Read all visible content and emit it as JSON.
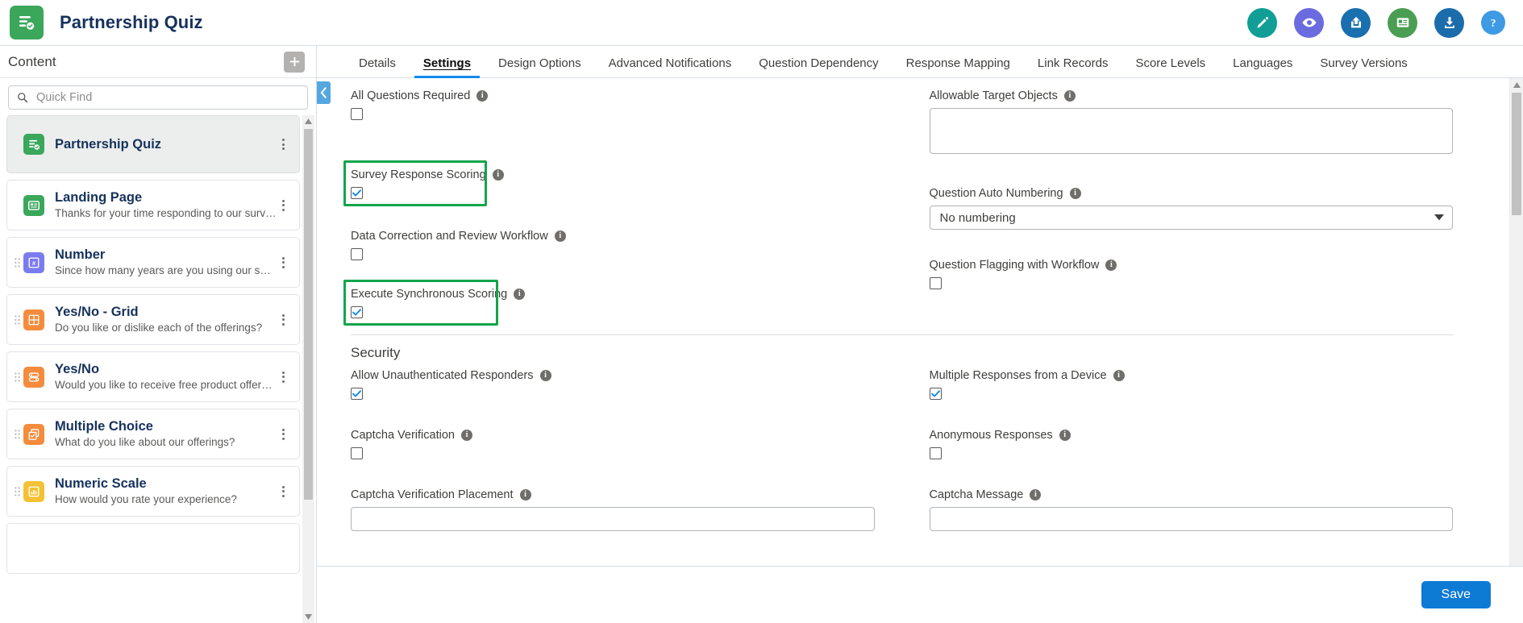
{
  "window": {
    "title": "Partnership Quiz",
    "logo_icon": "survey-form-icon"
  },
  "topbar": {
    "icons": [
      {
        "name": "edit-icon",
        "color": "#109e96"
      },
      {
        "name": "preview-eye-icon",
        "color": "#6b6be0"
      },
      {
        "name": "share-icon",
        "color": "#1a6fae"
      },
      {
        "name": "record-card-icon",
        "color": "#4a9e53"
      },
      {
        "name": "download-icon",
        "color": "#1b6cab"
      },
      {
        "name": "help-icon",
        "color": "#3e9ae3"
      }
    ]
  },
  "sidebar": {
    "header_title": "Content",
    "add_button_label": "+",
    "search": {
      "placeholder": "Quick Find",
      "value": ""
    },
    "items": [
      {
        "title": "Partnership Quiz",
        "subtitle": "",
        "icon": "survey-form-icon",
        "icon_color": "#3aa75b",
        "selected": true,
        "draggable": false
      },
      {
        "title": "Landing Page",
        "subtitle": "Thanks for your time responding to our survey. Please ...",
        "icon": "landing-page-icon",
        "icon_color": "#3aa75b",
        "selected": false,
        "draggable": false
      },
      {
        "title": "Number",
        "subtitle": "Since how many years are you using our services?",
        "icon": "number-question-icon",
        "icon_color": "#7b7bf0",
        "selected": false,
        "draggable": true
      },
      {
        "title": "Yes/No - Grid",
        "subtitle": "Do you like or dislike each of the offerings?",
        "icon": "grid-question-icon",
        "icon_color": "#f58b3c",
        "selected": false,
        "draggable": true
      },
      {
        "title": "Yes/No",
        "subtitle": "Would you like to receive free product offers via email?",
        "icon": "yesno-question-icon",
        "icon_color": "#f58b3c",
        "selected": false,
        "draggable": true
      },
      {
        "title": "Multiple Choice",
        "subtitle": "What do you like about our offerings?",
        "icon": "multiple-choice-icon",
        "icon_color": "#f58b3c",
        "selected": false,
        "draggable": true
      },
      {
        "title": "Numeric Scale",
        "subtitle": "How would you rate your experience?",
        "icon": "numeric-scale-icon",
        "icon_color": "#f4c034",
        "selected": false,
        "draggable": true
      }
    ]
  },
  "main": {
    "tabs": [
      {
        "label": "Details",
        "active": false
      },
      {
        "label": "Settings",
        "active": true
      },
      {
        "label": "Design Options",
        "active": false
      },
      {
        "label": "Advanced Notifications",
        "active": false
      },
      {
        "label": "Question Dependency",
        "active": false
      },
      {
        "label": "Response Mapping",
        "active": false
      },
      {
        "label": "Link Records",
        "active": false
      },
      {
        "label": "Score Levels",
        "active": false
      },
      {
        "label": "Languages",
        "active": false
      },
      {
        "label": "Survey Versions",
        "active": false
      }
    ],
    "collapse_icon": "chevron-left-icon",
    "fields": {
      "all_questions_required": {
        "label": "All Questions Required",
        "checked": false
      },
      "survey_response_scoring": {
        "label": "Survey Response Scoring",
        "checked": true,
        "highlighted": true
      },
      "data_correction_review_workflow": {
        "label": "Data Correction and Review Workflow",
        "checked": false
      },
      "execute_synchronous_scoring": {
        "label": "Execute Synchronous Scoring",
        "checked": true,
        "highlighted": true
      },
      "allowable_target_objects": {
        "label": "Allowable Target Objects",
        "value": ""
      },
      "question_auto_numbering": {
        "label": "Question Auto Numbering",
        "value": "No numbering"
      },
      "question_flagging_with_workflow": {
        "label": "Question Flagging with Workflow",
        "checked": false
      }
    },
    "security": {
      "title": "Security",
      "allow_unauthenticated_responders": {
        "label": "Allow Unauthenticated Responders",
        "checked": true
      },
      "multiple_responses_from_device": {
        "label": "Multiple Responses from a Device",
        "checked": true
      },
      "captcha_verification": {
        "label": "Captcha Verification",
        "checked": false
      },
      "anonymous_responses": {
        "label": "Anonymous Responses",
        "checked": false
      },
      "captcha_verification_placement": {
        "label": "Captcha Verification Placement",
        "value": ""
      },
      "captcha_message": {
        "label": "Captcha Message",
        "value": ""
      }
    }
  },
  "footer": {
    "save_label": "Save"
  },
  "colors": {
    "brand_green": "#3aa75b",
    "highlight_green": "#13a54a",
    "accent_blue": "#1589ee",
    "save_blue": "#0d7ad4"
  }
}
